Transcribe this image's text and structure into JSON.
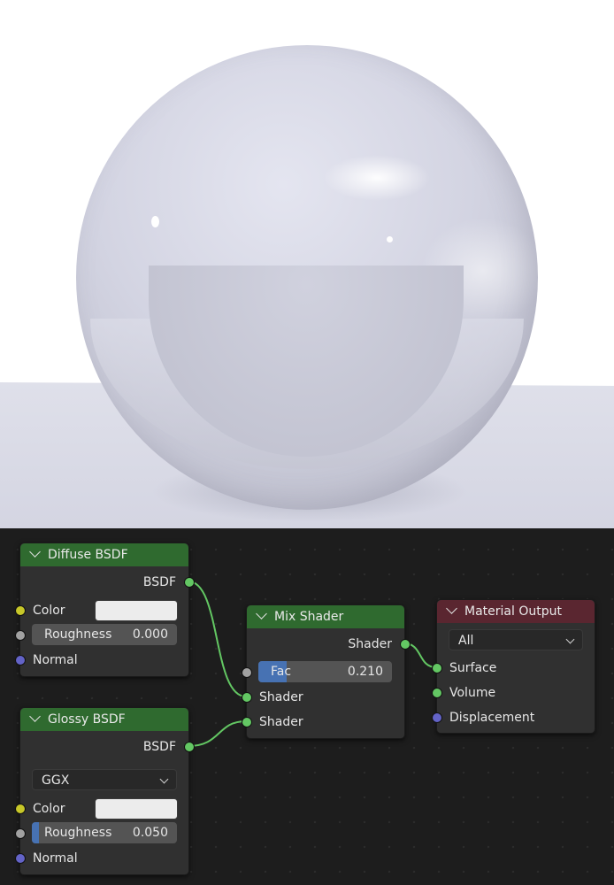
{
  "colors": {
    "socket_shader": "#63c763",
    "socket_color": "#c7c729",
    "socket_float": "#a1a1a1",
    "socket_vector": "#6363c7",
    "header_shader": "#2f6a2f",
    "header_output": "#5a2630",
    "slider_fill": "#4772b3"
  },
  "viewport": {
    "content": "render-preview"
  },
  "nodes": {
    "diffuse": {
      "title": "Diffuse BSDF",
      "output_bsdf": "BSDF",
      "color_label": "Color",
      "color_value": "#ececec",
      "roughness_label": "Roughness",
      "roughness_value": "0.000",
      "roughness_fraction": 0.0,
      "normal_label": "Normal"
    },
    "glossy": {
      "title": "Glossy BSDF",
      "output_bsdf": "BSDF",
      "distribution": "GGX",
      "color_label": "Color",
      "color_value": "#ececec",
      "roughness_label": "Roughness",
      "roughness_value": "0.050",
      "roughness_fraction": 0.05,
      "normal_label": "Normal"
    },
    "mix": {
      "title": "Mix Shader",
      "output_shader": "Shader",
      "fac_label": "Fac",
      "fac_value": "0.210",
      "fac_fraction": 0.21,
      "input_shader_1": "Shader",
      "input_shader_2": "Shader"
    },
    "output": {
      "title": "Material Output",
      "target": "All",
      "surface_label": "Surface",
      "volume_label": "Volume",
      "displacement_label": "Displacement"
    }
  }
}
